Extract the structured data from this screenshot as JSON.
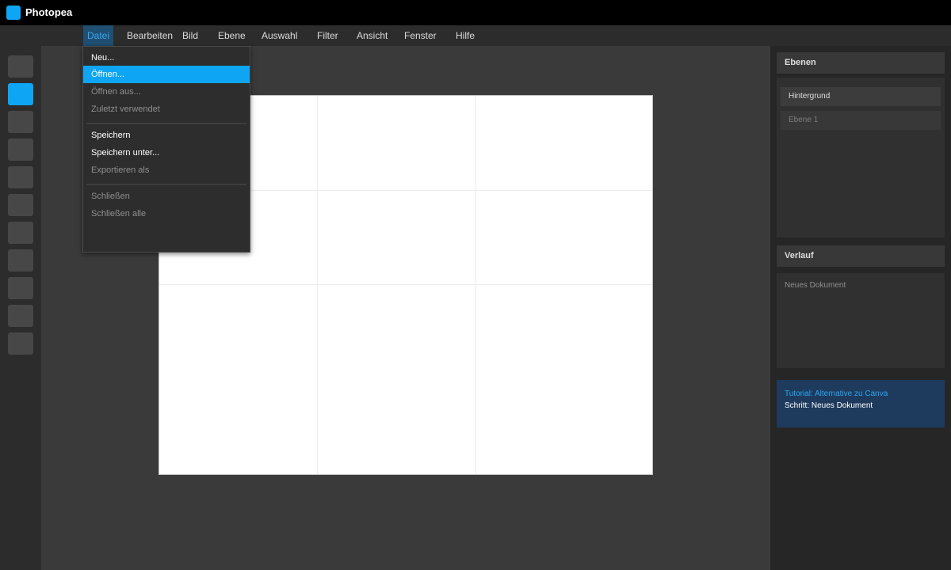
{
  "app": {
    "title": "Photopea",
    "logo_color": "#0ea5f5"
  },
  "menubar": {
    "items": [
      {
        "label": "Datei",
        "active": true
      },
      {
        "label": "Bearbeiten"
      },
      {
        "label": "Bild"
      },
      {
        "label": "Ebene"
      },
      {
        "label": "Auswahl"
      },
      {
        "label": "Filter"
      },
      {
        "label": "Ansicht"
      },
      {
        "label": "Fenster"
      },
      {
        "label": "Hilfe"
      }
    ]
  },
  "file_menu": {
    "items": [
      {
        "label": "Neu...",
        "enabled": true
      },
      {
        "label": "Öffnen...",
        "enabled": true,
        "highlighted": true
      },
      {
        "label": "Öffnen aus...",
        "enabled": false
      },
      {
        "label": "Zuletzt verwendet",
        "enabled": false
      },
      {
        "label": "Speichern",
        "enabled": true
      },
      {
        "label": "Speichern unter...",
        "enabled": true
      },
      {
        "label": "Exportieren als",
        "enabled": false
      },
      {
        "label": "Schließen",
        "enabled": false
      },
      {
        "label": "Schließen alle",
        "enabled": false
      }
    ]
  },
  "toolbar": {
    "tool_count": 11,
    "selected_index": 1,
    "accent": "#0ea5f5"
  },
  "layers_panel": {
    "title": "Ebenen",
    "layers": [
      {
        "name": "Hintergrund",
        "active": true
      },
      {
        "name": "Ebene 1",
        "active": false
      }
    ]
  },
  "history_panel": {
    "title": "Verlauf",
    "entries": [
      "Neues Dokument"
    ]
  },
  "tutorial": {
    "title": "Tutorial: Alternative zu Canva",
    "step": "Schritt: Neues Dokument",
    "accent": "#2ea6f0"
  }
}
